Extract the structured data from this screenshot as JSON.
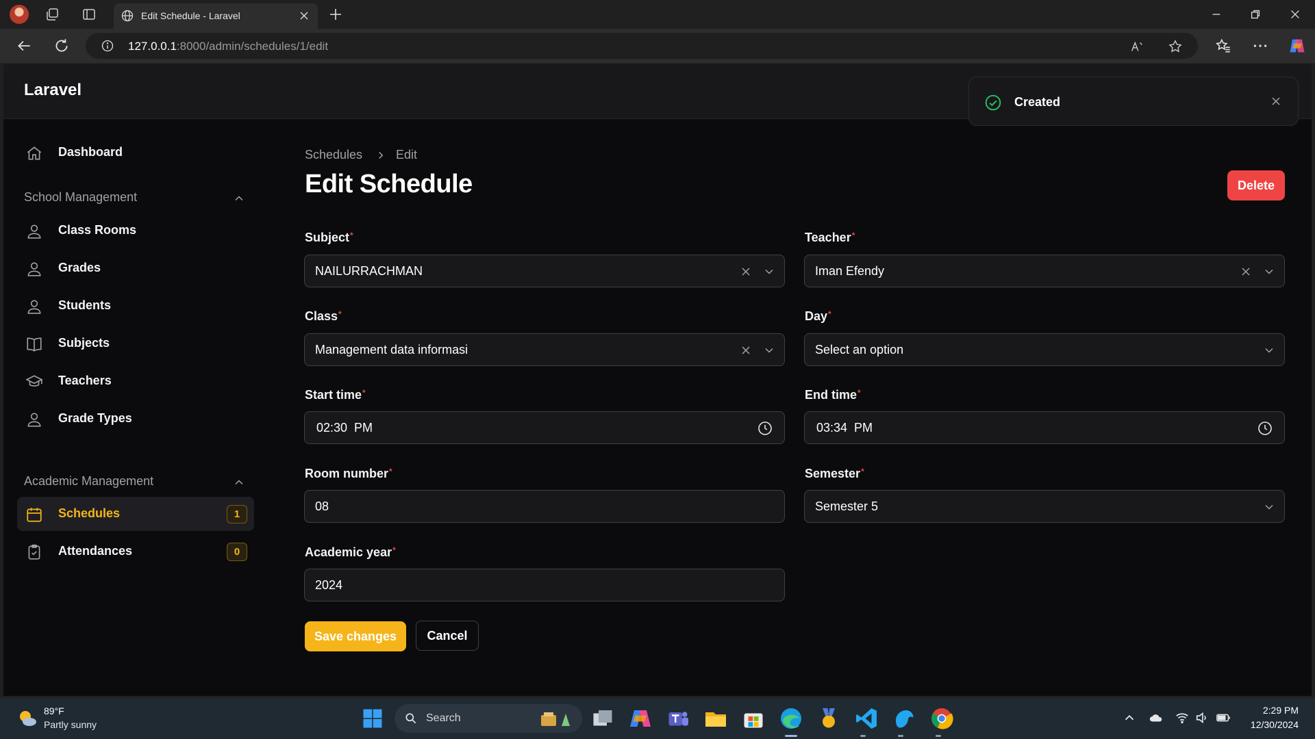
{
  "browser": {
    "tab_title": "Edit Schedule - Laravel",
    "url_host": "127.0.0.1",
    "url_path": ":8000/admin/schedules/1/edit"
  },
  "app": {
    "brand": "Laravel",
    "accent_color": "#f5b51a",
    "danger_color": "#ef4444"
  },
  "sidebar": {
    "dashboard": "Dashboard",
    "groups": [
      {
        "label": "School Management",
        "items": [
          "Class Rooms",
          "Grades",
          "Students",
          "Subjects",
          "Teachers",
          "Grade Types"
        ]
      },
      {
        "label": "Academic Management",
        "items": [
          "Schedules",
          "Attendances"
        ]
      }
    ],
    "schedules_badge": "1",
    "attendances_badge": "0"
  },
  "breadcrumb": [
    "Schedules",
    "Edit"
  ],
  "page": {
    "title": "Edit Schedule",
    "delete_label": "Delete"
  },
  "form": {
    "subject": {
      "label": "Subject",
      "value": "NAILURRACHMAN"
    },
    "teacher": {
      "label": "Teacher",
      "value": "Iman Efendy"
    },
    "class": {
      "label": "Class",
      "value": "Management data informasi"
    },
    "day": {
      "label": "Day",
      "value": "Select an option"
    },
    "start_time": {
      "label": "Start time",
      "value": "02:30  PM"
    },
    "end_time": {
      "label": "End time",
      "value": "03:34  PM"
    },
    "room_number": {
      "label": "Room number",
      "value": "08"
    },
    "semester": {
      "label": "Semester",
      "value": "Semester 5"
    },
    "academic_year": {
      "label": "Academic year",
      "value": "2024"
    },
    "required_mark": "*",
    "save_label": "Save changes",
    "cancel_label": "Cancel"
  },
  "toast": {
    "message": "Created"
  },
  "taskbar": {
    "temperature": "89°F",
    "condition": "Partly sunny",
    "search_label": "Search",
    "time": "2:29 PM",
    "date": "12/30/2024"
  },
  "icons": [
    "profile-avatar-icon",
    "workspaces-icon",
    "tab-actions-icon",
    "globe-icon",
    "close-icon",
    "plus-icon",
    "minimize-icon",
    "restore-icon",
    "back-icon",
    "refresh-icon",
    "info-icon",
    "read-aloud-icon",
    "star-icon",
    "favorites-icon",
    "more-icon",
    "copilot-icon",
    "home-icon",
    "user-icon",
    "book-icon",
    "graduation-cap-icon",
    "calendar-icon",
    "clipboard-icon",
    "chevron-up-icon",
    "chevron-down-icon",
    "x-icon",
    "clock-icon",
    "check-circle-icon",
    "weather-icon",
    "windows-start-icon",
    "search-icon"
  ]
}
